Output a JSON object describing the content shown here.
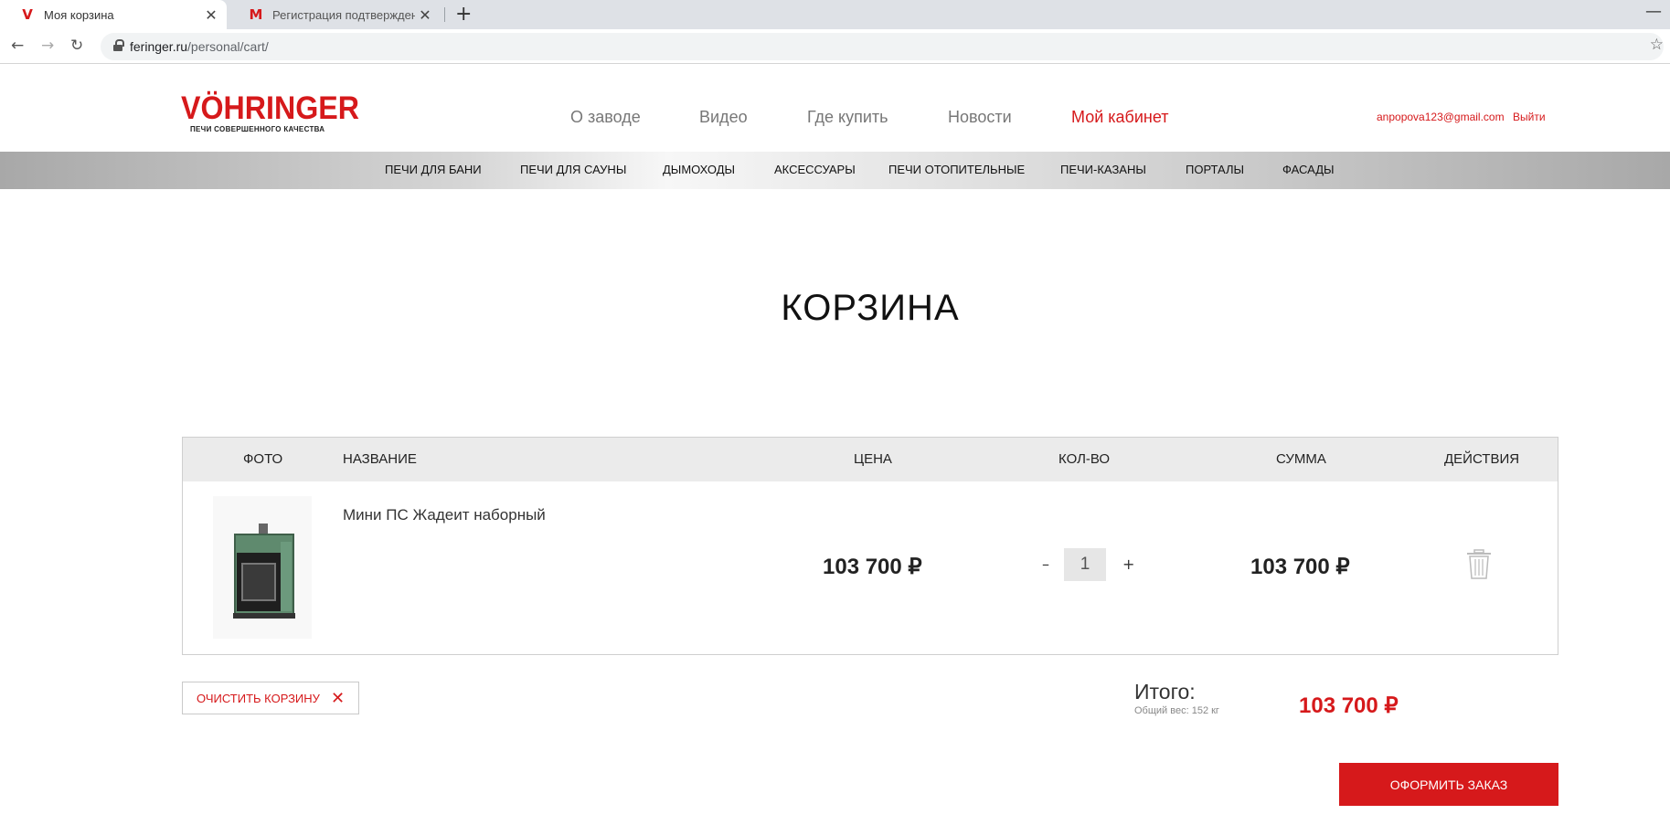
{
  "browser": {
    "tabs": [
      {
        "title": "Моя корзина",
        "favicon": "V",
        "active": true
      },
      {
        "title": "Регистрация подтверждена - an",
        "favicon": "M",
        "active": false
      }
    ],
    "url_host": "feringer.ru",
    "url_path": "/personal/cart/"
  },
  "site": {
    "logo_text": "VÖHRINGER",
    "logo_slogan": "ПЕЧИ СОВЕРШЕННОГО КАЧЕСТВА",
    "brand_color": "#d6191b",
    "top_nav": [
      "О заводе",
      "Видео",
      "Где купить",
      "Новости",
      "Мой кабинет"
    ],
    "top_nav_active": "Мой кабинет",
    "user_email": "anpopova123@gmail.com",
    "logout_label": "Выйти",
    "categories": [
      "ПЕЧИ ДЛЯ БАНИ",
      "ПЕЧИ ДЛЯ САУНЫ",
      "ДЫМОХОДЫ",
      "АКСЕССУАРЫ",
      "ПЕЧИ ОТОПИТЕЛЬНЫЕ",
      "ПЕЧИ-КАЗАНЫ",
      "ПОРТАЛЫ",
      "ФАСАДЫ"
    ]
  },
  "cart": {
    "title": "КОРЗИНА",
    "columns": {
      "photo": "ФОТО",
      "name": "НАЗВАНИЕ",
      "price": "ЦЕНА",
      "qty": "КОЛ-ВО",
      "sum": "СУММА",
      "actions": "ДЕЙСТВИЯ"
    },
    "items": [
      {
        "name": "Мини ПС Жадеит наборный",
        "price": "103 700 ₽",
        "qty": "1",
        "sum": "103 700 ₽"
      }
    ],
    "clear_label": "ОЧИСТИТЬ КОРЗИНУ",
    "total_label": "Итого:",
    "weight_label": "Общий вес: 152 кг",
    "total_value": "103 700 ₽",
    "order_label": "ОФОРМИТЬ ЗАКАЗ"
  }
}
